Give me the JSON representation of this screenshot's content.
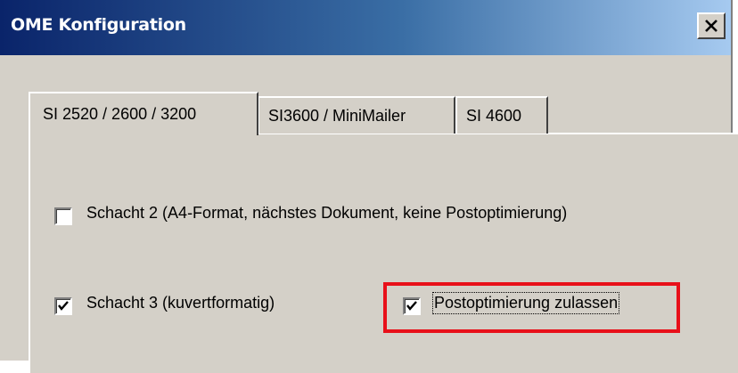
{
  "window": {
    "title": "OME Konfiguration",
    "close_icon": "close-icon"
  },
  "tabs": [
    {
      "label": "SI 2520 / 2600 / 3200",
      "active": true
    },
    {
      "label": "SI3600 / MiniMailer",
      "active": false
    },
    {
      "label": "SI 4600",
      "active": false
    }
  ],
  "options": {
    "schacht2": {
      "label": "Schacht 2 (A4-Format, nächstes Dokument, keine Postoptimierung)",
      "checked": false
    },
    "schacht3": {
      "label": "Schacht 3 (kuvertformatig)",
      "checked": true
    },
    "postopt": {
      "label": "Postoptimierung zulassen",
      "checked": true
    }
  },
  "colors": {
    "title_bar_start": "#0a246a",
    "title_bar_end": "#a6caf0",
    "highlight": "#e8101a",
    "dialog_bg": "#d4d0c8"
  }
}
